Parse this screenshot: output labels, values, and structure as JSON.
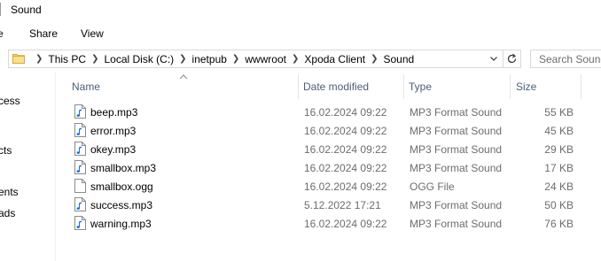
{
  "window": {
    "title": "Sound"
  },
  "ribbon": {
    "tabs": [
      "e",
      "Share",
      "View"
    ]
  },
  "address": {
    "crumbs": [
      "This PC",
      "Local Disk (C:)",
      "inetpub",
      "wwwroot",
      "Xpoda Client",
      "Sound"
    ]
  },
  "search": {
    "placeholder": "Search Sound"
  },
  "nav": {
    "items": [
      "cess",
      "cts",
      "ents",
      "ads"
    ]
  },
  "columns": {
    "name": "Name",
    "date": "Date modified",
    "type": "Type",
    "size": "Size"
  },
  "files": [
    {
      "name": "beep.mp3",
      "date": "16.02.2024 09:22",
      "type": "MP3 Format Sound",
      "size": "55 KB",
      "icon": "audio-file-icon"
    },
    {
      "name": "error.mp3",
      "date": "16.02.2024 09:22",
      "type": "MP3 Format Sound",
      "size": "45 KB",
      "icon": "audio-file-icon"
    },
    {
      "name": "okey.mp3",
      "date": "16.02.2024 09:22",
      "type": "MP3 Format Sound",
      "size": "29 KB",
      "icon": "audio-file-icon"
    },
    {
      "name": "smallbox.mp3",
      "date": "16.02.2024 09:22",
      "type": "MP3 Format Sound",
      "size": "17 KB",
      "icon": "audio-file-icon"
    },
    {
      "name": "smallbox.ogg",
      "date": "16.02.2024 09:22",
      "type": "OGG File",
      "size": "24 KB",
      "icon": "blank-file-icon"
    },
    {
      "name": "success.mp3",
      "date": "5.12.2022 17:21",
      "type": "MP3 Format Sound",
      "size": "50 KB",
      "icon": "audio-file-icon"
    },
    {
      "name": "warning.mp3",
      "date": "16.02.2024 09:22",
      "type": "MP3 Format Sound",
      "size": "76 KB",
      "icon": "audio-file-icon"
    }
  ],
  "colors": {
    "header_text": "#4c607a",
    "meta_text": "#6d6d6d",
    "audio_note": "#1e6fd0"
  }
}
